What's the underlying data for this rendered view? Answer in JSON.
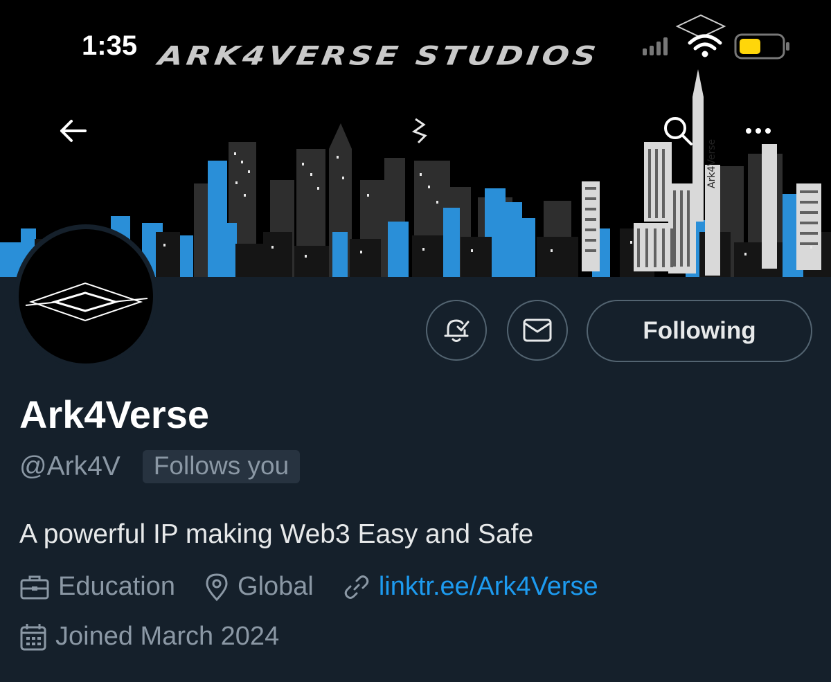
{
  "status_bar": {
    "time": "1:35"
  },
  "banner": {
    "title": "ARK4VERSE STUDIOS",
    "tower_label": "Ark4Verse"
  },
  "profile": {
    "display_name": "Ark4Verse",
    "handle": "@Ark4V",
    "follows_you": "Follows you",
    "bio": "A powerful IP making Web3 Easy and Safe",
    "category": "Education",
    "location": "Global",
    "website": "linktr.ee/Ark4Verse",
    "joined": "Joined March 2024"
  },
  "actions": {
    "following_label": "Following"
  },
  "icons": {
    "back": "arrow-left-icon",
    "search": "search-icon",
    "more": "more-icon",
    "notify": "bell-check-icon",
    "message": "envelope-icon",
    "category": "briefcase-icon",
    "location": "location-pin-icon",
    "website": "link-icon",
    "joined": "calendar-icon"
  },
  "colors": {
    "background": "#15202b",
    "banner": "#000000",
    "accent_link": "#1d9bf0",
    "secondary_text": "#8b98a5",
    "battery": "#ffd60a",
    "city_blue": "#2a8fd8",
    "city_gray": "#3a3a3a"
  }
}
